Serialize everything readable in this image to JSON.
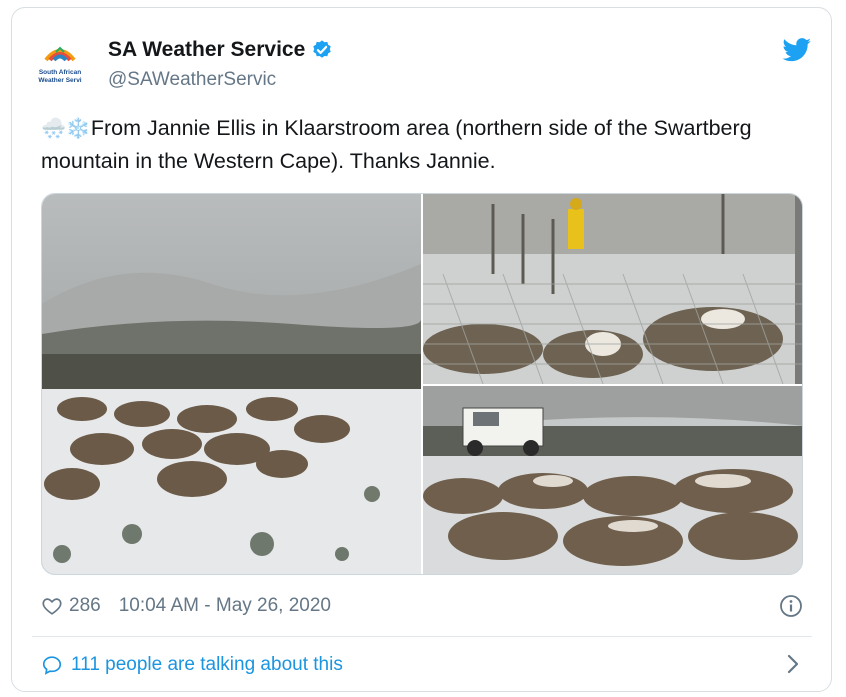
{
  "tweet": {
    "author_name": "SA Weather Service",
    "handle": "@SAWeatherServic",
    "logo_text_line1": "South African",
    "logo_text_line2": "Weather Servi",
    "emoji_prefix": "🌨️❄️",
    "text": "From Jannie Ellis in Klaarstroom area (northern side of the Swartberg mountain in the Western Cape). Thanks Jannie.",
    "likes": "286",
    "timestamp": "10:04 AM - May 26, 2020",
    "conversation": "111 people are talking about this"
  },
  "media": [
    {
      "description_icon": "photo-sheep-snow-field"
    },
    {
      "description_icon": "photo-sheep-pen"
    },
    {
      "description_icon": "photo-bakkie-sheep"
    }
  ],
  "colors": {
    "brand_blue": "#1da1f2",
    "link_blue": "#1b95e0",
    "muted": "#657786",
    "text": "#14171a"
  }
}
